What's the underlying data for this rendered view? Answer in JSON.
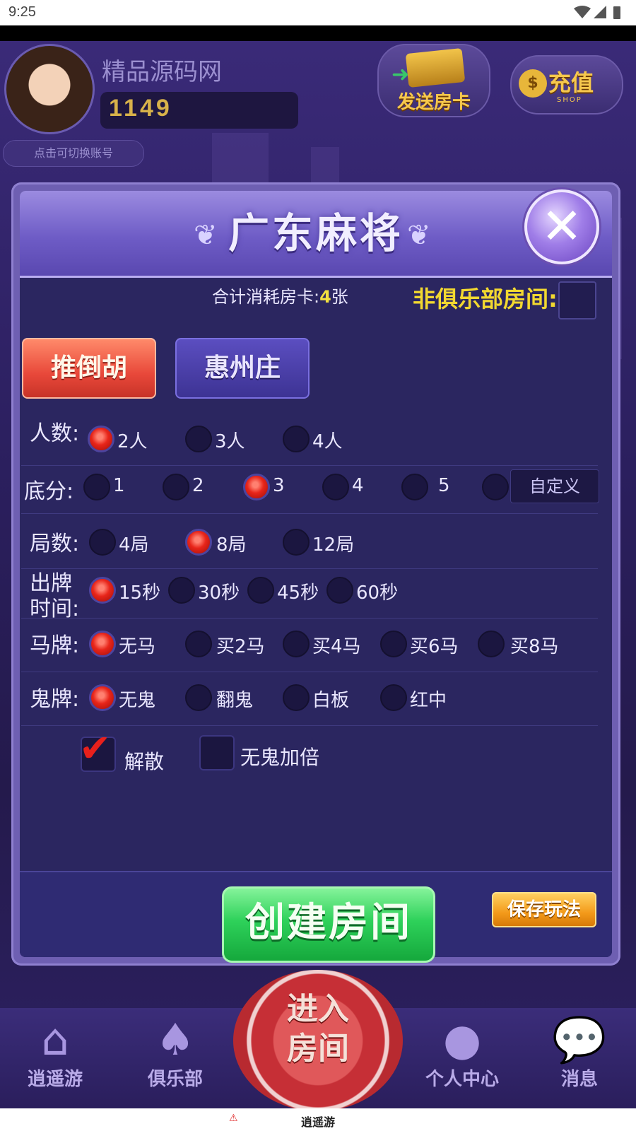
{
  "status_bar": {
    "time": "9:25"
  },
  "header": {
    "username": "精品源码网",
    "coins": "1149",
    "switch_account": "点击可切换账号",
    "send_card": "发送房卡",
    "send_card_small": "房卡",
    "recharge": "充值",
    "recharge_small": "SHOP"
  },
  "dialog": {
    "title": "广东麻将",
    "cost_label": "合计消耗房卡:",
    "cost_value": "4",
    "cost_unit": "张",
    "non_club_label": "非俱乐部房间:",
    "tabs": [
      "推倒胡",
      "惠州庄"
    ],
    "rows": {
      "players": {
        "label": "人数:",
        "options": [
          "2人",
          "3人",
          "4人"
        ],
        "selected": "2人"
      },
      "base_score": {
        "label": "底分:",
        "options": [
          "1",
          "2",
          "3",
          "4",
          "5"
        ],
        "custom": "自定义",
        "selected": "3"
      },
      "rounds": {
        "label": "局数:",
        "options": [
          "4局",
          "8局",
          "12局"
        ],
        "selected": "8局"
      },
      "play_time": {
        "label_line1": "出牌",
        "label_line2": "时间:",
        "options": [
          "15秒",
          "30秒",
          "45秒",
          "60秒"
        ],
        "selected": "15秒"
      },
      "horse": {
        "label": "马牌:",
        "options": [
          "无马",
          "买2马",
          "买4马",
          "买6马",
          "买8马"
        ],
        "selected": "无马"
      },
      "ghost": {
        "label": "鬼牌:",
        "options": [
          "无鬼",
          "翻鬼",
          "白板",
          "红中"
        ],
        "selected": "无鬼"
      }
    },
    "checkboxes": [
      {
        "label": "解散",
        "checked": true
      },
      {
        "label": "无鬼加倍",
        "checked": false
      }
    ],
    "create_button": "创建房间",
    "save_button": "保存玩法"
  },
  "bottom_nav": {
    "items": [
      "逍遥游",
      "俱乐部",
      "个人中心",
      "消息"
    ],
    "enter_room": "进入房间",
    "enter_room_l1": "进入",
    "enter_room_l2": "房间"
  },
  "system_window": {
    "title": "逍遥游"
  },
  "colors": {
    "accent_gold": "#f2d830",
    "radio_selected": "#e8251a",
    "create_green": "#2ed15a",
    "save_orange": "#f39a1a",
    "dialog_bg": "#2b2660"
  }
}
